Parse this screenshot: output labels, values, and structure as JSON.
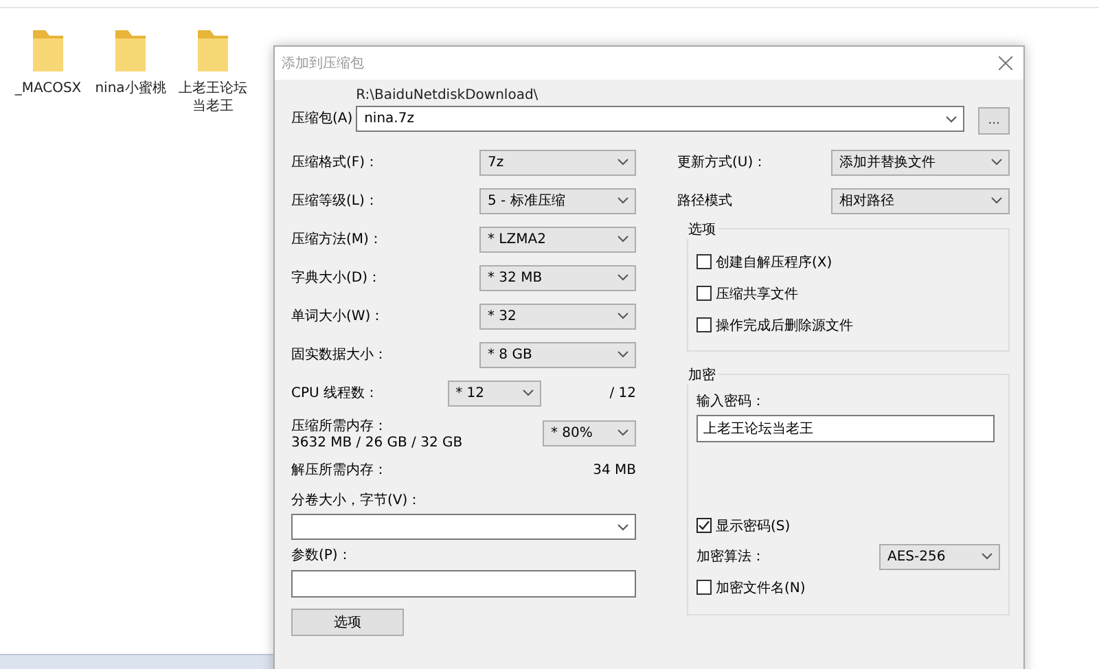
{
  "desktop_icons": [
    {
      "label": "_MACOSX"
    },
    {
      "label": "nina小蜜桃"
    },
    {
      "label": "上老王论坛当老王"
    }
  ],
  "dialog": {
    "title": "添加到压缩包",
    "archive": {
      "label": "压缩包(A)",
      "path": "R:\\BaiduNetdiskDownload\\",
      "value": "nina.7z",
      "browse": "..."
    },
    "left_rows": [
      {
        "kind": "select",
        "label": "压缩格式(F)：",
        "value": "7z"
      },
      {
        "kind": "select",
        "label": "压缩等级(L)：",
        "value": "5 - 标准压缩"
      },
      {
        "kind": "select",
        "label": "压缩方法(M)：",
        "value": "* LZMA2"
      },
      {
        "kind": "select",
        "label": "字典大小(D)：",
        "value": "* 32 MB"
      },
      {
        "kind": "select",
        "label": "单词大小(W)：",
        "value": "* 32"
      },
      {
        "kind": "select",
        "label": "固实数据大小：",
        "value": "* 8 GB"
      },
      {
        "kind": "threads",
        "label": "CPU 线程数：",
        "value": "* 12",
        "note": "/ 12"
      },
      {
        "kind": "memory",
        "label": "压缩所需内存：",
        "detail": "3632 MB / 26 GB / 32 GB",
        "value": "* 80%"
      },
      {
        "kind": "info",
        "label": "解压所需内存：",
        "value": "34 MB"
      }
    ],
    "volume": {
      "label": "分卷大小，字节(V)："
    },
    "params": {
      "label": "参数(P)："
    },
    "options_button": "选项",
    "right_selects": [
      {
        "label": "更新方式(U)：",
        "value": "添加并替换文件"
      },
      {
        "label": "路径模式",
        "value": "相对路径"
      }
    ],
    "options_group": {
      "title": "选项",
      "checkboxes": [
        {
          "label": "创建自解压程序(X)",
          "checked": false
        },
        {
          "label": "压缩共享文件",
          "checked": false
        },
        {
          "label": "操作完成后删除源文件",
          "checked": false
        }
      ]
    },
    "encryption": {
      "title": "加密",
      "password_label": "输入密码：",
      "password": "上老王论坛当老王",
      "show_password": {
        "label": "显示密码(S)",
        "checked": true
      },
      "method_label": "加密算法：",
      "method": "AES-256",
      "encrypt_names": {
        "label": "加密文件名(N)",
        "checked": false
      }
    }
  }
}
